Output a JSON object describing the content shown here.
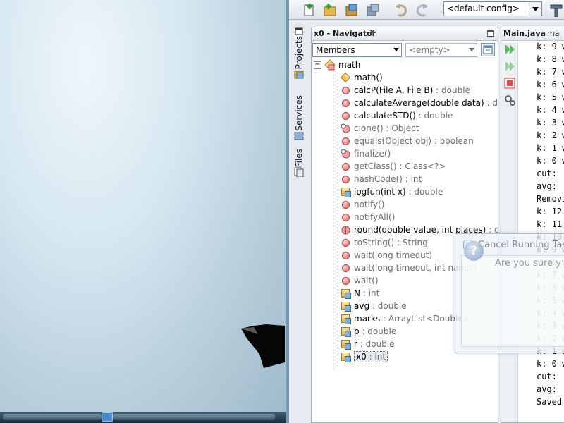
{
  "toolbar": {
    "config_value": "<default config>",
    "icons": [
      "new-file-icon",
      "new-project-icon",
      "open-project-icon",
      "close-project-icon",
      "undo-icon",
      "redo-icon",
      "hammer-icon"
    ]
  },
  "side_tabs": [
    "Projects",
    "Services",
    "Files"
  ],
  "navigator": {
    "tab_label": "x0 - Navigator",
    "close_glyph": "✖",
    "filter_value": "Members",
    "scope_value": "<empty>",
    "root": "math",
    "members": [
      {
        "name": "math",
        "sig": "()",
        "type": "",
        "icon": "constructor",
        "inherited": false
      },
      {
        "name": "calcP",
        "sig": "(File A, File B)",
        "type": " : double",
        "icon": "method",
        "inherited": false
      },
      {
        "name": "calculateAverage",
        "sig": "(double data)",
        "type": " : do",
        "icon": "method",
        "inherited": false
      },
      {
        "name": "calculateSTD",
        "sig": "()",
        "type": " : double",
        "icon": "method",
        "inherited": false
      },
      {
        "name": "clone",
        "sig": "()",
        "type": " : Object",
        "icon": "method-protected",
        "inherited": true
      },
      {
        "name": "equals",
        "sig": "(Object obj)",
        "type": " : boolean",
        "icon": "method",
        "inherited": true
      },
      {
        "name": "finalize",
        "sig": "()",
        "type": "",
        "icon": "method-protected",
        "inherited": true
      },
      {
        "name": "getClass",
        "sig": "()",
        "type": " : Class<?>",
        "icon": "method",
        "inherited": true
      },
      {
        "name": "hashCode",
        "sig": "()",
        "type": " : int",
        "icon": "method",
        "inherited": true
      },
      {
        "name": "logfun",
        "sig": "(int x)",
        "type": " : double",
        "icon": "method-package",
        "inherited": false
      },
      {
        "name": "notify",
        "sig": "()",
        "type": "",
        "icon": "method",
        "inherited": true
      },
      {
        "name": "notifyAll",
        "sig": "()",
        "type": "",
        "icon": "method",
        "inherited": true
      },
      {
        "name": "round",
        "sig": "(double value, int places)",
        "type": " : do",
        "icon": "method-static",
        "inherited": false
      },
      {
        "name": "toString",
        "sig": "()",
        "type": " : String",
        "icon": "method",
        "inherited": true
      },
      {
        "name": "wait",
        "sig": "(long timeout)",
        "type": "",
        "icon": "method",
        "inherited": true
      },
      {
        "name": "wait",
        "sig": "(long timeout, int nanos)",
        "type": "",
        "icon": "method",
        "inherited": true
      },
      {
        "name": "wait",
        "sig": "()",
        "type": "",
        "icon": "method",
        "inherited": true
      },
      {
        "name": "N",
        "sig": "",
        "type": " : int",
        "icon": "field",
        "inherited": false
      },
      {
        "name": "avg",
        "sig": "",
        "type": " : double",
        "icon": "field",
        "inherited": false
      },
      {
        "name": "marks",
        "sig": "",
        "type": " : ArrayList<Double>",
        "icon": "field",
        "inherited": false
      },
      {
        "name": "p",
        "sig": "",
        "type": " : double",
        "icon": "field",
        "inherited": false
      },
      {
        "name": "r",
        "sig": "",
        "type": " : double",
        "icon": "field",
        "inherited": false
      },
      {
        "name": "x0",
        "sig": "",
        "type": " : int",
        "icon": "field",
        "inherited": false,
        "selected": true
      }
    ]
  },
  "editor": {
    "tabs": [
      "Main.java",
      "ma"
    ],
    "output_lines": [
      "k: 9 w",
      "k: 8 w",
      "k: 7 w",
      "k: 6 w",
      "k: 5 w",
      "k: 4 w",
      "k: 3 w",
      "k: 2 w",
      "k: 1 w",
      "k: 0 w",
      "cut: ",
      "avg: ",
      "Removi",
      "k: 12 ",
      "k: 11 ",
      "k: 10 ",
      "k: 9 w",
      "k: 8 w",
      "k: 7 w",
      "k: 6 w",
      "k: 5 w",
      "k: 4 w",
      "k: 3 w",
      "k: 2 w",
      "k: 1 w",
      "k: 0 w",
      "cut: ",
      "avg: ",
      "Saved "
    ],
    "side_icons": [
      "rerun-icon",
      "rerun-with-args-icon",
      "stop-icon",
      "settings-icon"
    ]
  },
  "dialog": {
    "title": "Cancel Running Tas",
    "message": "Are you sure y"
  },
  "colors": {
    "accent": "#6f9ab8",
    "method_icon": "#e68c8c",
    "field_icon": "#e2b040"
  }
}
